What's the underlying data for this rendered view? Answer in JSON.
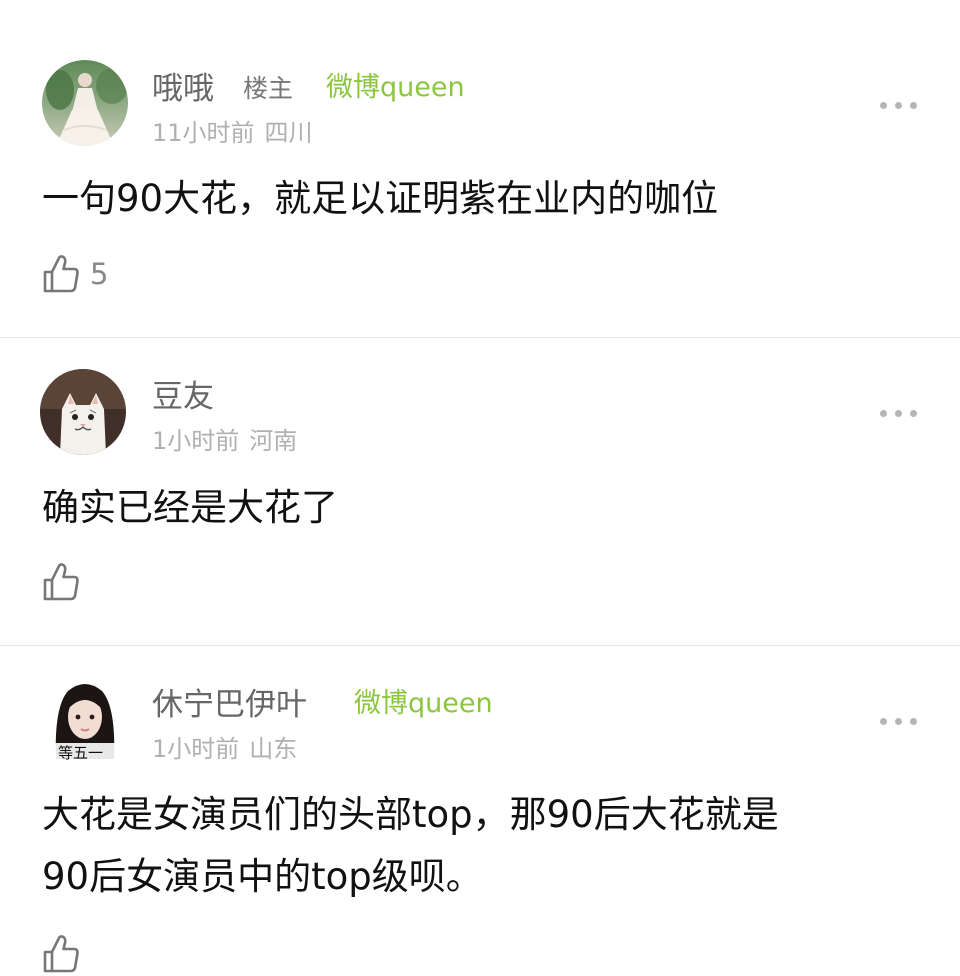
{
  "comments": [
    {
      "username": "哦哦",
      "op_tag": "楼主",
      "badge": "微博queen",
      "time": "11小时前",
      "location": "四川",
      "content_lines": [
        "一句90大花，就足以证明紫在业内的咖位"
      ],
      "likes": "5",
      "avatar_icon": "bride-photo-avatar"
    },
    {
      "username": "豆友",
      "time": "1小时前",
      "location": "河南",
      "content_lines": [
        "确实已经是大花了"
      ],
      "likes": "",
      "avatar_icon": "cat-photo-avatar"
    },
    {
      "username": "休宁巴伊叶",
      "badge": "微博queen",
      "time": "1小时前",
      "location": "山东",
      "content_lines": [
        "大花是女演员们的头部top，那90后大花就是",
        "90后女演员中的top级呗。"
      ],
      "likes": "",
      "avatar_icon": "girl-portrait-avatar",
      "avatar_caption": "等五一"
    }
  ],
  "icons": {
    "like": "thumbs-up-icon",
    "more": "more-dots-icon"
  },
  "colors": {
    "badge": "#8cc63f",
    "meta": "#b0b0b0",
    "username": "#666666",
    "icon": "#777777"
  }
}
